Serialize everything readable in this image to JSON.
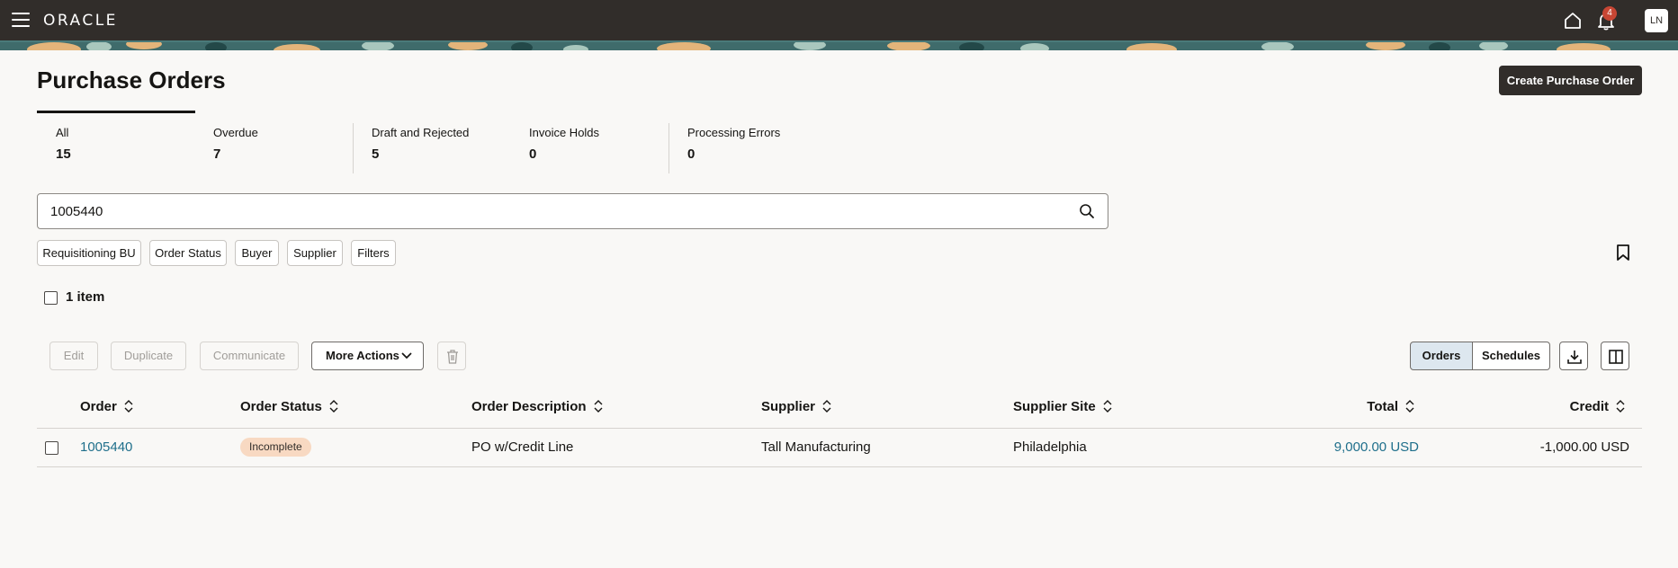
{
  "header": {
    "brand": "ORACLE",
    "notifications_count": "4",
    "user_initials": "LN",
    "icons": [
      "menu-icon",
      "home-icon",
      "bell-icon"
    ]
  },
  "page": {
    "title": "Purchase Orders",
    "create_button": "Create Purchase Order"
  },
  "tabs": [
    {
      "label": "All",
      "count": "15"
    },
    {
      "label": "Overdue",
      "count": "7"
    },
    {
      "label": "Draft and Rejected",
      "count": "5"
    },
    {
      "label": "Invoice Holds",
      "count": "0"
    },
    {
      "label": "Processing Errors",
      "count": "0"
    }
  ],
  "search": {
    "value": "1005440"
  },
  "filter_chips": [
    "Requisitioning BU",
    "Order Status",
    "Buyer",
    "Supplier",
    "Filters"
  ],
  "results": {
    "count_label": "1 item"
  },
  "toolbar": {
    "edit": "Edit",
    "duplicate": "Duplicate",
    "communicate": "Communicate",
    "more_actions": "More Actions",
    "view_orders": "Orders",
    "view_schedules": "Schedules"
  },
  "table": {
    "columns": [
      "Order",
      "Order Status",
      "Order Description",
      "Supplier",
      "Supplier Site",
      "Total",
      "Credit"
    ],
    "rows": [
      {
        "order": "1005440",
        "status": "Incomplete",
        "description": "PO w/Credit Line",
        "supplier": "Tall Manufacturing",
        "site": "Philadelphia",
        "total": "9,000.00 USD",
        "credit": "-1,000.00 USD"
      }
    ]
  },
  "colors": {
    "topbar": "#312d2a",
    "link": "#1f6f8b",
    "status_badge": "#f8d9c2",
    "selected_segment": "#dde7ef"
  }
}
